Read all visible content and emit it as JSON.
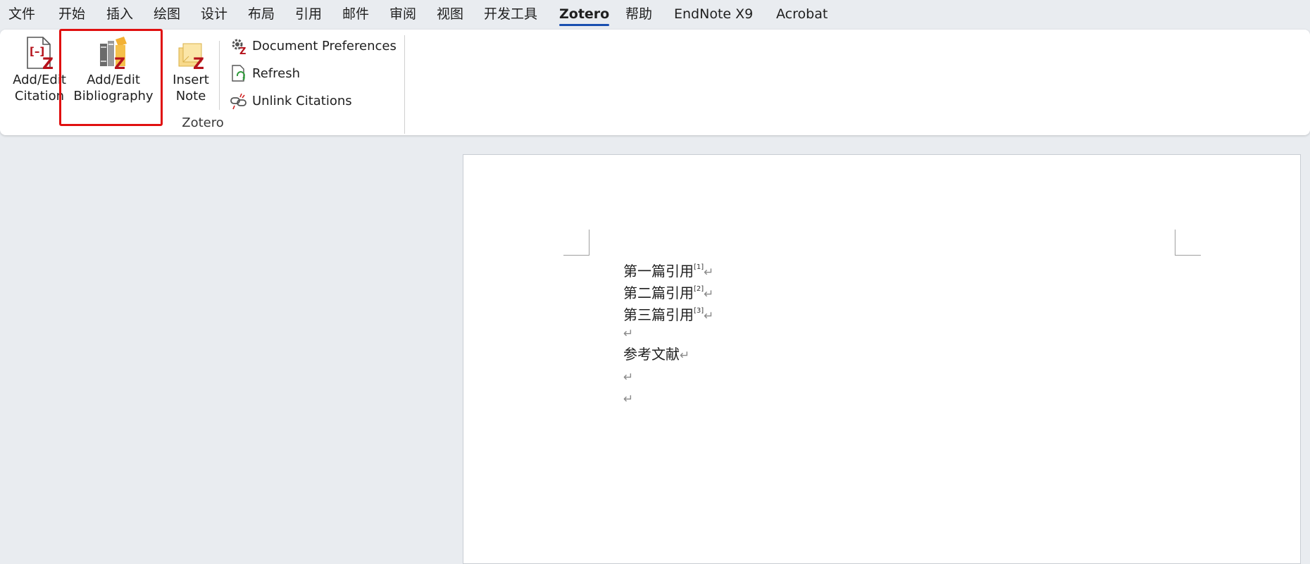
{
  "menu": {
    "items": [
      {
        "label": "文件"
      },
      {
        "label": "开始"
      },
      {
        "label": "插入"
      },
      {
        "label": "绘图"
      },
      {
        "label": "设计"
      },
      {
        "label": "布局"
      },
      {
        "label": "引用"
      },
      {
        "label": "邮件"
      },
      {
        "label": "审阅"
      },
      {
        "label": "视图"
      },
      {
        "label": "开发工具"
      },
      {
        "label": "Zotero",
        "active": true
      },
      {
        "label": "帮助"
      },
      {
        "label": "EndNote X9"
      },
      {
        "label": "Acrobat"
      }
    ]
  },
  "ribbon": {
    "add_edit_citation": {
      "line1": "Add/Edit",
      "line2": "Citation"
    },
    "add_edit_bibliography": {
      "line1": "Add/Edit",
      "line2": "Bibliography"
    },
    "insert_note": {
      "line1": "Insert",
      "line2": "Note"
    },
    "document_preferences": "Document Preferences",
    "refresh": "Refresh",
    "unlink_citations": "Unlink Citations",
    "group_label": "Zotero"
  },
  "document": {
    "lines": [
      {
        "text": "第一篇引用",
        "sup": "[1]"
      },
      {
        "text": "第二篇引用",
        "sup": "[2]"
      },
      {
        "text": "第三篇引用",
        "sup": "[3]"
      },
      {
        "text": "",
        "sup": ""
      },
      {
        "text": "参考文献",
        "sup": ""
      },
      {
        "text": "",
        "sup": ""
      },
      {
        "text": "",
        "sup": ""
      }
    ],
    "paragraph_mark": "↵"
  },
  "colors": {
    "accent": "#1a4fb0",
    "highlight": "#e01010",
    "zotero_red": "#b5121b"
  }
}
